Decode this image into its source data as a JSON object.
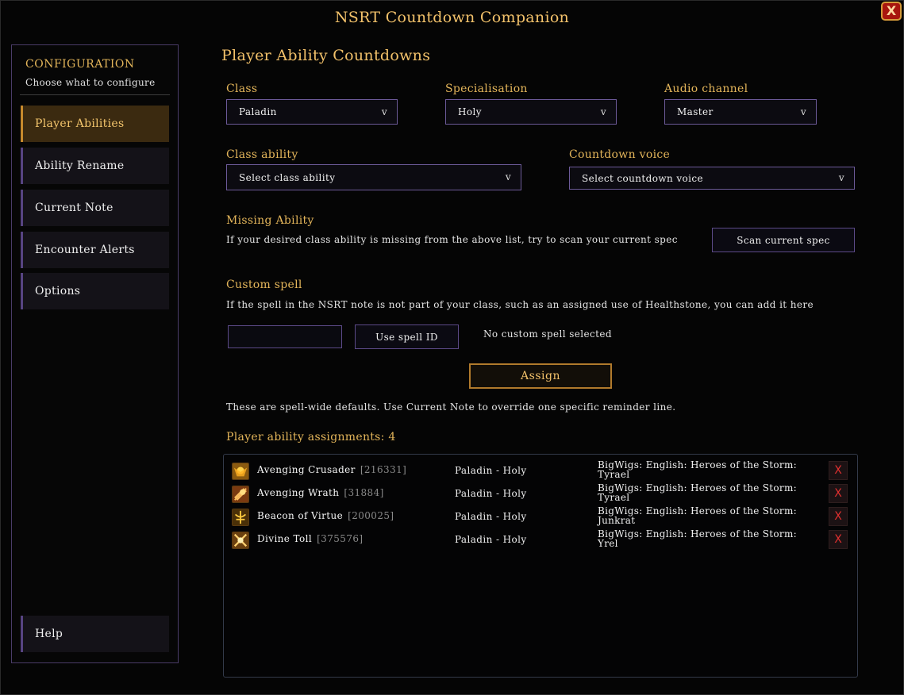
{
  "window": {
    "title": "NSRT Countdown Companion",
    "close_label": "X"
  },
  "sidebar": {
    "heading": "CONFIGURATION",
    "subheading": "Choose what to configure",
    "items": [
      {
        "label": "Player Abilities"
      },
      {
        "label": "Ability Rename"
      },
      {
        "label": "Current Note"
      },
      {
        "label": "Encounter Alerts"
      },
      {
        "label": "Options"
      }
    ],
    "help_label": "Help"
  },
  "main": {
    "title": "Player Ability Countdowns",
    "class": {
      "label": "Class",
      "value": "Paladin"
    },
    "specialisation": {
      "label": "Specialisation",
      "value": "Holy"
    },
    "audio_channel": {
      "label": "Audio channel",
      "value": "Master"
    },
    "class_ability": {
      "label": "Class ability",
      "value": "Select class ability"
    },
    "countdown_voice": {
      "label": "Countdown voice",
      "value": "Select countdown voice"
    },
    "dropdown_chevron": "v",
    "missing_ability": {
      "label": "Missing Ability",
      "description": "If your desired class ability is missing from the above list, try to scan your current spec",
      "button_label": "Scan current spec"
    },
    "custom_spell": {
      "label": "Custom spell",
      "description": "If the spell in the NSRT note is not part of your class, such as an assigned use of Healthstone, you can add it here",
      "input_value": "",
      "use_button_label": "Use spell ID",
      "status": "No custom spell selected"
    },
    "assign_label": "Assign",
    "defaults_note": "These are spell-wide defaults. Use Current Note to override one specific reminder line.",
    "assignments_heading": "Player ability assignments: 4",
    "assignments": [
      {
        "name": "Avenging Crusader",
        "spell_id": "[216331]",
        "spec": "Paladin - Holy",
        "voice_line1": "BigWigs: English: Heroes of the Storm:",
        "voice_line2": "Tyrael",
        "delete_label": "X",
        "icon": "avenging-crusader-icon"
      },
      {
        "name": "Avenging Wrath",
        "spell_id": "[31884]",
        "spec": "Paladin - Holy",
        "voice_line1": "BigWigs: English: Heroes of the Storm:",
        "voice_line2": "Tyrael",
        "delete_label": "X",
        "icon": "avenging-wrath-icon"
      },
      {
        "name": "Beacon of Virtue",
        "spell_id": "[200025]",
        "spec": "Paladin - Holy",
        "voice_line1": "BigWigs: English: Heroes of the Storm:",
        "voice_line2": "Junkrat",
        "delete_label": "X",
        "icon": "beacon-of-virtue-icon"
      },
      {
        "name": "Divine Toll",
        "spell_id": "[375576]",
        "spec": "Paladin - Holy",
        "voice_line1": "BigWigs: English: Heroes of the Storm:",
        "voice_line2": "Yrel",
        "delete_label": "X",
        "icon": "divine-toll-icon"
      }
    ]
  },
  "colors": {
    "gold": "#f2c16a",
    "accent_purple": "#6c5a98",
    "active_nav": "#3b2a10",
    "delete_red": "#e03030"
  }
}
